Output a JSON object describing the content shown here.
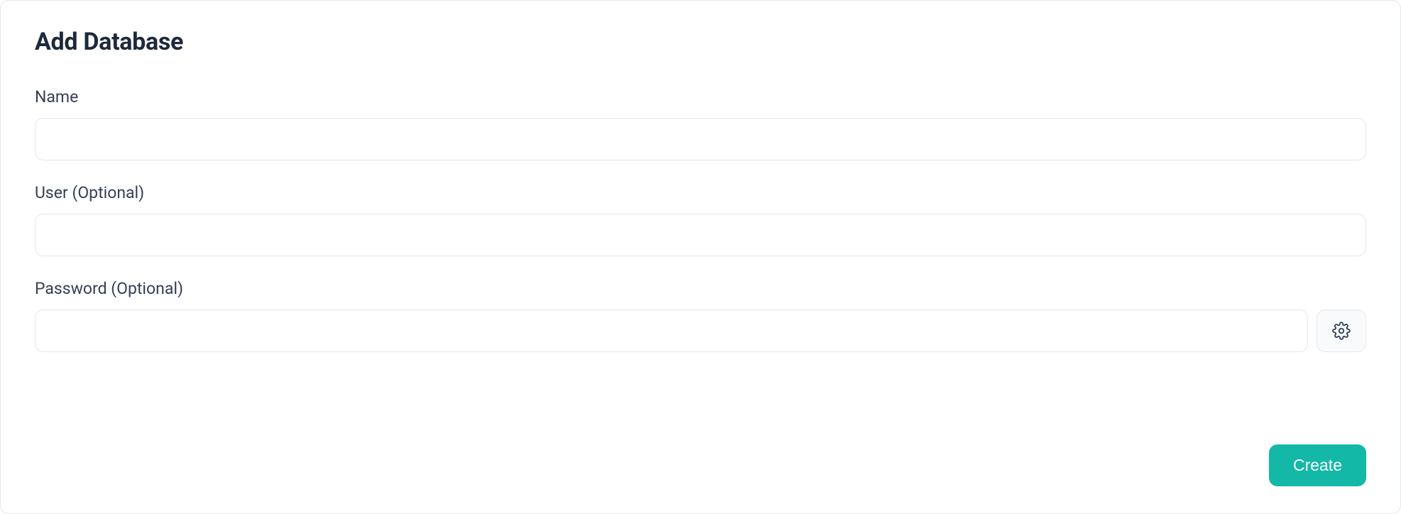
{
  "page": {
    "title": "Add Database"
  },
  "form": {
    "name": {
      "label": "Name",
      "value": ""
    },
    "user": {
      "label": "User (Optional)",
      "value": ""
    },
    "password": {
      "label": "Password (Optional)",
      "value": ""
    }
  },
  "actions": {
    "create_label": "Create"
  }
}
